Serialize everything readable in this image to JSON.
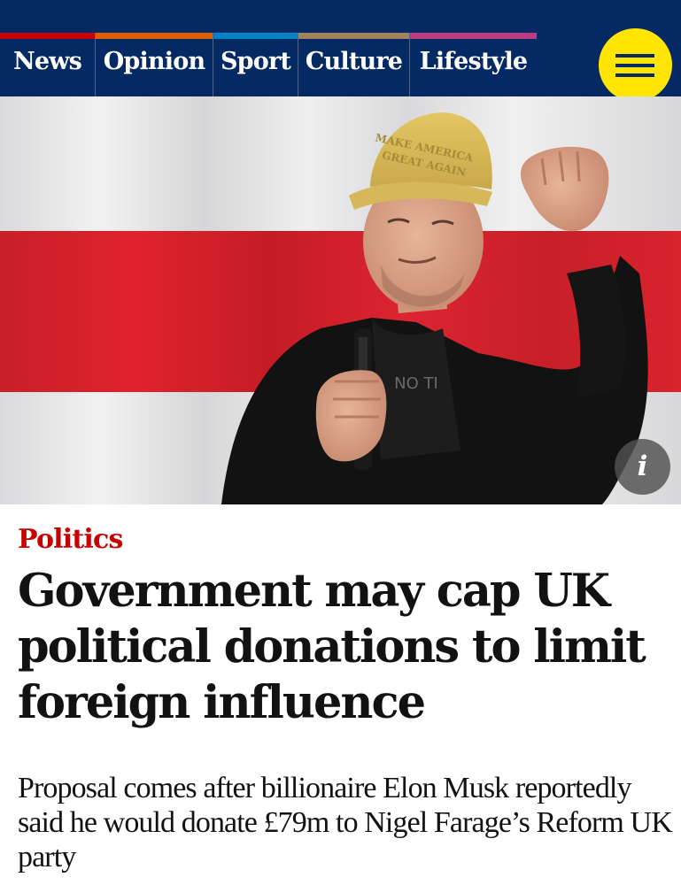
{
  "nav": {
    "items": [
      {
        "label": "News",
        "color": "#c70000"
      },
      {
        "label": "Opinion",
        "color": "#e05e00"
      },
      {
        "label": "Sport",
        "color": "#0084c6"
      },
      {
        "label": "Culture",
        "color": "#a1845c"
      },
      {
        "label": "Lifestyle",
        "color": "#bb3b80"
      }
    ],
    "menu_icon": "hamburger-menu-icon",
    "background": "#052962",
    "menu_color": "#ffe500"
  },
  "hero": {
    "info_label": "i",
    "info_icon": "info-icon",
    "cap_text": [
      "MAKE AMERICA",
      "GREAT AGAIN"
    ],
    "shirt_text": "NO TI"
  },
  "article": {
    "kicker": "Politics",
    "kicker_color": "#c70000",
    "headline": "Government may cap UK political donations to limit foreign influence",
    "standfirst": "Proposal comes after billionaire Elon Musk reportedly said he would donate £79m to Nigel Farage’s Reform UK party"
  }
}
